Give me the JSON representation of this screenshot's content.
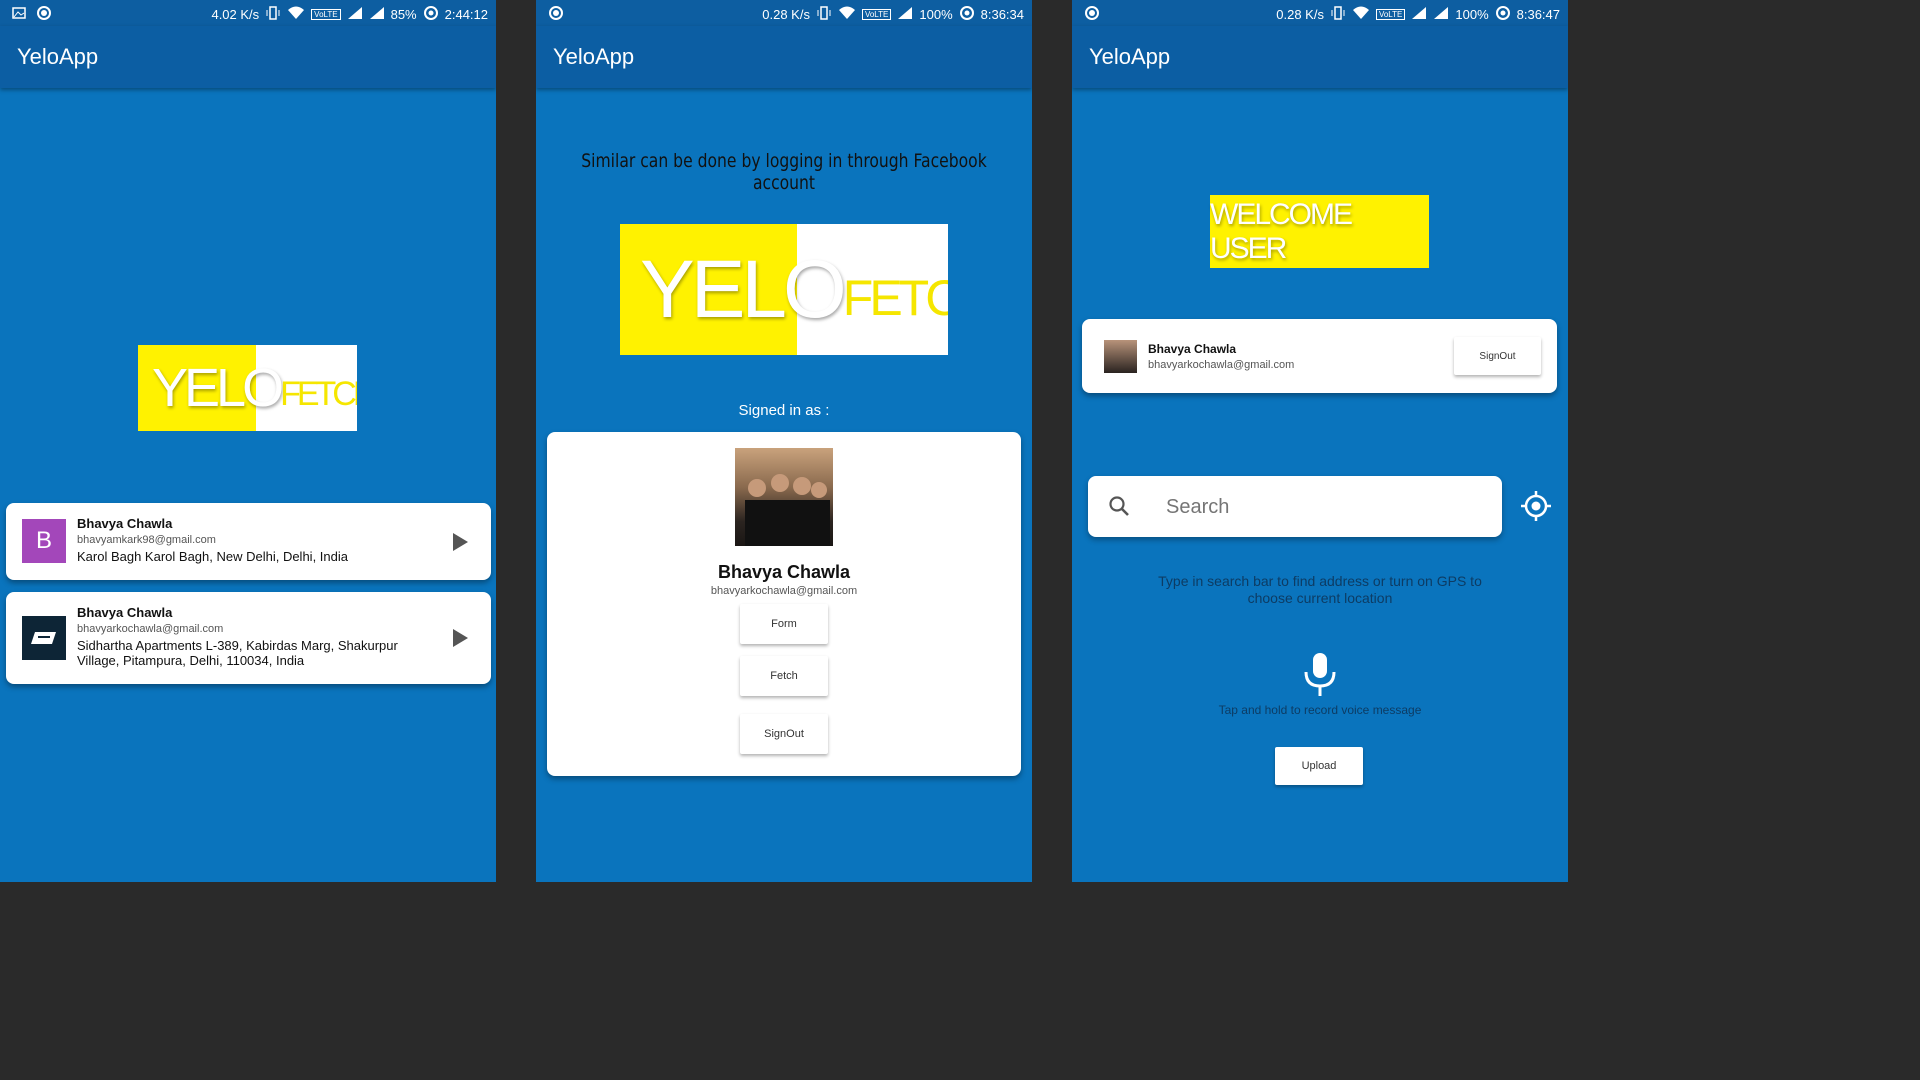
{
  "app": {
    "title": "YeloApp"
  },
  "screens": [
    {
      "status": {
        "speed": "4.02 K/s",
        "volte": "VoLTE",
        "battery": "85%",
        "time": "2:44:12"
      },
      "logo": {
        "part1": "YELO",
        "part2": "FETCH"
      },
      "accounts": [
        {
          "initial": "B",
          "name": "Bhavya Chawla",
          "email": "bhavyamkark98@gmail.com",
          "address": "Karol Bagh Karol Bagh, New Delhi, Delhi, India"
        },
        {
          "name": "Bhavya Chawla",
          "email": "bhavyarkochawla@gmail.com",
          "address": "Sidhartha Apartments L-389, Kabirdas Marg, Shakurpur Village, Pitampura, Delhi, 110034, India"
        }
      ]
    },
    {
      "status": {
        "speed": "0.28 K/s",
        "volte": "VoLTE",
        "battery": "100%",
        "time": "8:36:34"
      },
      "heading": "Similar can be done by logging in through Facebook account",
      "logo": {
        "part1": "YELO",
        "part2": "FETCH"
      },
      "signed_in_label": "Signed in as :",
      "profile": {
        "name": "Bhavya Chawla",
        "email": "bhavyarkochawla@gmail.com"
      },
      "buttons": {
        "form": "Form",
        "fetch": "Fetch",
        "signout": "SignOut"
      }
    },
    {
      "status": {
        "speed": "0.28 K/s",
        "volte": "VoLTE",
        "battery": "100%",
        "time": "8:36:47"
      },
      "welcome": "WELCOME USER",
      "profile": {
        "name": "Bhavya Chawla",
        "email": "bhavyarkochawla@gmail.com",
        "signout": "SignOut"
      },
      "search": {
        "placeholder": "Search"
      },
      "hint": "Type in search bar to find address or turn on GPS to choose current location",
      "voice_hint": "Tap and hold to record voice message",
      "upload": "Upload"
    }
  ],
  "colors": {
    "background": "#0a74bd",
    "appbar": "#0c5ea3",
    "yellow": "#fff200",
    "avatar_purple": "#a347ba"
  }
}
